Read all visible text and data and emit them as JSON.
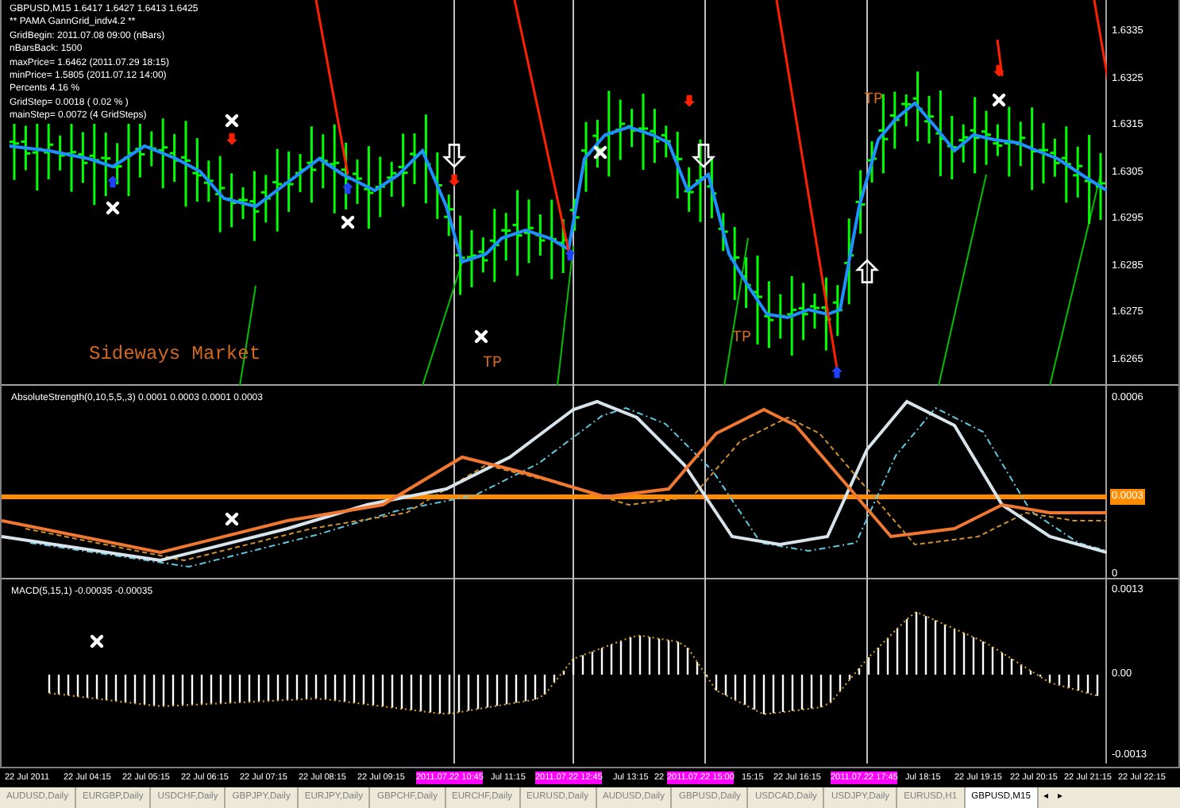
{
  "main_panel": {
    "info_lines": [
      "GBPUSD,M15  1.6417 1.6427 1.6413 1.6425",
      "** PAMA GannGrid_indv4.2 **",
      "GridBegin: 2011.07.08 09:00  (nBars)",
      "nBarsBack: 1500",
      "maxPrice= 1.6462  (2011.07.29 18:15)",
      "minPrice= 1.5805  (2011.07.12 14:00)",
      "Percents 4.16 %",
      "GridStep= 0.0018 ( 0.02 % )",
      "mainStep= 0.0072 (4 GridSteps)"
    ],
    "annotations": [
      {
        "kind": "market",
        "text": "Sideways Market"
      },
      {
        "kind": "tp",
        "text": "TP"
      },
      {
        "kind": "tp",
        "text": "TP"
      },
      {
        "kind": "tp",
        "text": "TP"
      }
    ],
    "axis_labels": [
      {
        "text": "1.6335",
        "highlighted": false
      },
      {
        "text": "1.6325",
        "highlighted": false
      },
      {
        "text": "1.6315",
        "highlighted": false
      },
      {
        "text": "1.6305",
        "highlighted": false
      },
      {
        "text": "1.6295",
        "highlighted": false
      },
      {
        "text": "1.6285",
        "highlighted": false
      },
      {
        "text": "1.6275",
        "highlighted": false
      },
      {
        "text": "1.6265",
        "highlighted": false
      }
    ]
  },
  "indicator_panel": {
    "title": "AbsoluteStrength(0,10,5,5,,3) 0.0001 0.0003 0.0001 0.0003",
    "axis_labels": [
      {
        "text": "0.0006",
        "highlighted": false
      },
      {
        "text": "0.0003",
        "highlighted": true
      },
      {
        "text": "0",
        "highlighted": false
      }
    ]
  },
  "macd_panel": {
    "title": "MACD(5,15,1) -0.00035 -0.00035",
    "axis_labels": [
      {
        "text": "0.0013",
        "highlighted": false
      },
      {
        "text": "0.00",
        "highlighted": false
      },
      {
        "text": "-0.0013",
        "highlighted": false
      }
    ]
  },
  "time_axis": [
    {
      "text": "22 Jul 2011",
      "highlighted": false
    },
    {
      "text": "22 Jul 04:15",
      "highlighted": false
    },
    {
      "text": "22 Jul 05:15",
      "highlighted": false
    },
    {
      "text": "22 Jul 06:15",
      "highlighted": false
    },
    {
      "text": "22 Jul 07:15",
      "highlighted": false
    },
    {
      "text": "22 Jul 08:15",
      "highlighted": false
    },
    {
      "text": "22 Jul 09:15",
      "highlighted": false
    },
    {
      "text": "2011.07.22 10:45",
      "highlighted": true
    },
    {
      "text": "Jul 11:15",
      "highlighted": false
    },
    {
      "text": "2011.07.22 12:45",
      "highlighted": true
    },
    {
      "text": "Jul 13:15",
      "highlighted": false
    },
    {
      "text": "22",
      "highlighted": false
    },
    {
      "text": "2011.07.22 15:00",
      "highlighted": true
    },
    {
      "text": "15:15",
      "highlighted": false
    },
    {
      "text": "22 Jul 16:15",
      "highlighted": false
    },
    {
      "text": "2011.07.22 17:45",
      "highlighted": true
    },
    {
      "text": "Jul 18:15",
      "highlighted": false
    },
    {
      "text": "22 Jul 19:15",
      "highlighted": false
    },
    {
      "text": "22 Jul 20:15",
      "highlighted": false
    },
    {
      "text": "22 Jul 21:15",
      "highlighted": false
    },
    {
      "text": "22 Jul 22:15",
      "highlighted": false
    }
  ],
  "tabs": [
    {
      "label": "AUDUSD,Daily",
      "selected": false
    },
    {
      "label": "EURGBP,Daily",
      "selected": false
    },
    {
      "label": "USDCHF,Daily",
      "selected": false
    },
    {
      "label": "GBPJPY,Daily",
      "selected": false
    },
    {
      "label": "EURJPY,Daily",
      "selected": false
    },
    {
      "label": "GBPCHF,Daily",
      "selected": false
    },
    {
      "label": "EURCHF,Daily",
      "selected": false
    },
    {
      "label": "EURUSD,Daily",
      "selected": false
    },
    {
      "label": "AUDUSD,Daily",
      "selected": false
    },
    {
      "label": "GBPUSD,Daily",
      "selected": false
    },
    {
      "label": "USDCAD,Daily",
      "selected": false
    },
    {
      "label": "USDJPY,Daily",
      "selected": false
    },
    {
      "label": "EURUSD,H1",
      "selected": false
    },
    {
      "label": "GBPUSD,M15",
      "selected": true
    }
  ],
  "tab_scroll": [
    "◂",
    "▸"
  ]
}
